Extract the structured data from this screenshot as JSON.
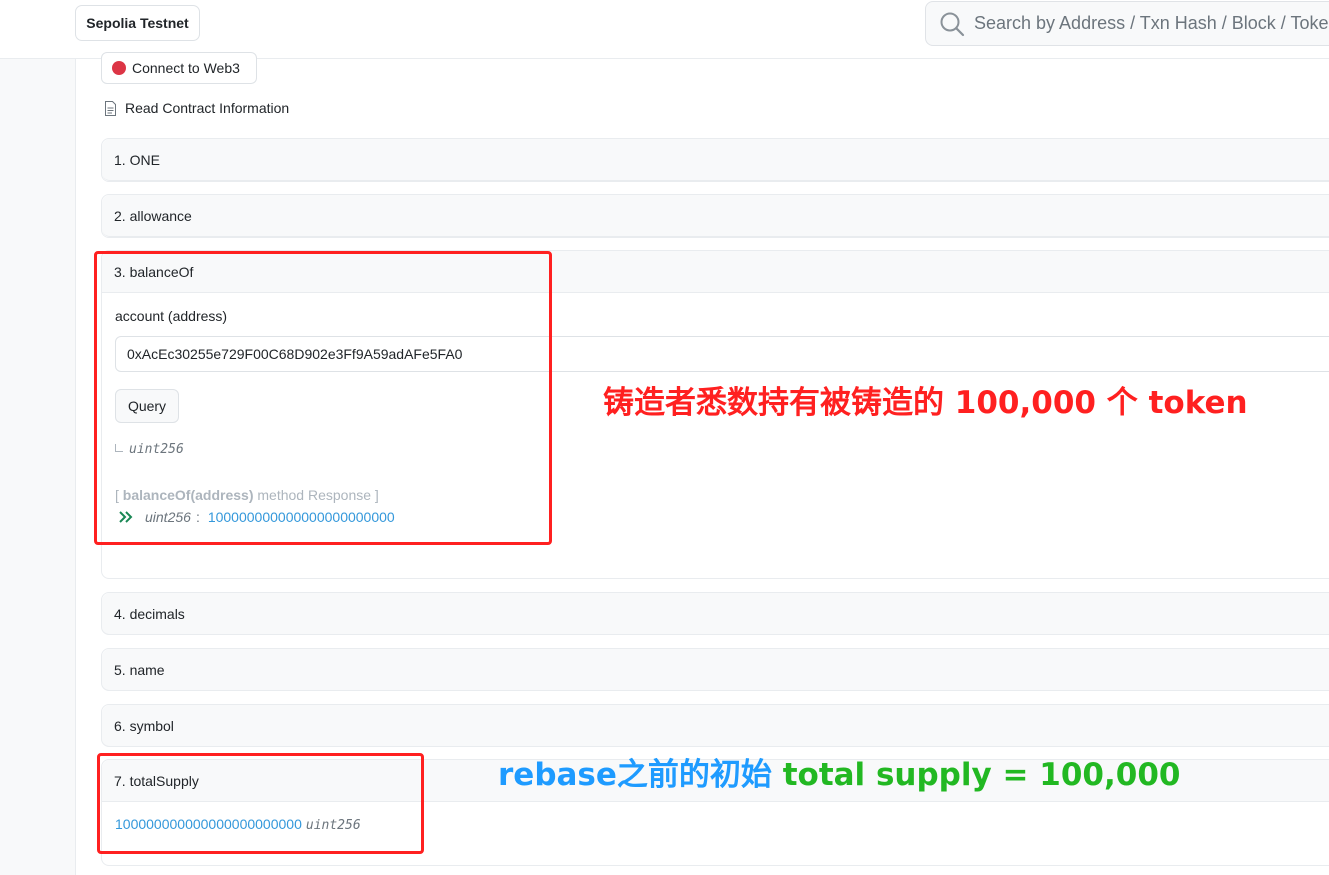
{
  "header": {
    "network": "Sepolia Testnet",
    "search_placeholder": "Search by Address / Txn Hash / Block / Token"
  },
  "contract": {
    "connect_label": "Connect to Web3",
    "read_info_label": "Read Contract Information",
    "functions": [
      {
        "label": "1. ONE"
      },
      {
        "label": "2. allowance"
      },
      {
        "label": "3. balanceOf"
      },
      {
        "label": "4. decimals"
      },
      {
        "label": "5. name"
      },
      {
        "label": "6. symbol"
      },
      {
        "label": "7. totalSupply"
      }
    ],
    "balanceOf": {
      "param_label": "account (address)",
      "param_value": "0xAcEc30255e729F00C68D902e3Ff9A59adAFe5FA0",
      "query_label": "Query",
      "return_type": "uint256",
      "response_open": "[ ",
      "response_method": "balanceOf(address)",
      "response_suffix": " method Response ]",
      "response_type": "uint256",
      "response_value": "100000000000000000000000"
    },
    "totalSupply": {
      "value": "100000000000000000000000",
      "type": "uint256"
    }
  },
  "annotations": {
    "note1": "铸造者悉数持有被铸造的 100,000 个 token",
    "note2_blue": "rebase之前的初始",
    "note2_green": " total supply = 100,000"
  },
  "colors": {
    "annotation_red": "#ff2020",
    "annotation_blue": "#1e9bff",
    "annotation_green": "#22b822",
    "link_blue": "#3498db",
    "status_dot": "#dc3545"
  }
}
